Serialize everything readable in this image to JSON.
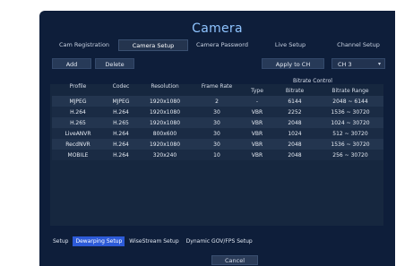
{
  "title": "Camera",
  "tabs": [
    {
      "label": "Cam Registration"
    },
    {
      "label": "Camera Setup"
    },
    {
      "label": "Camera Password"
    },
    {
      "label": "Live Setup"
    },
    {
      "label": "Channel Setup"
    }
  ],
  "active_tab": "Camera Setup",
  "toolbar": {
    "add_label": "Add",
    "delete_label": "Delete",
    "apply_label": "Apply to CH",
    "channel_value": "CH 3"
  },
  "table": {
    "group_header": "Bitrate Control",
    "headers": {
      "profile": "Profile",
      "codec": "Codec",
      "resolution": "Resolution",
      "frame_rate": "Frame Rate",
      "type": "Type",
      "bitrate": "Bitrate",
      "bitrate_range": "Bitrate Range"
    },
    "rows": [
      {
        "profile": "MJPEG",
        "codec": "MJPEG",
        "resolution": "1920x1080",
        "frame_rate": "2",
        "type": "-",
        "bitrate": "6144",
        "range": "2048 ~ 6144"
      },
      {
        "profile": "H.264",
        "codec": "H.264",
        "resolution": "1920x1080",
        "frame_rate": "30",
        "type": "VBR",
        "bitrate": "2252",
        "range": "1536 ~ 30720"
      },
      {
        "profile": "H.265",
        "codec": "H.265",
        "resolution": "1920x1080",
        "frame_rate": "30",
        "type": "VBR",
        "bitrate": "2048",
        "range": "1024 ~ 30720"
      },
      {
        "profile": "LiveANVR",
        "codec": "H.264",
        "resolution": "800x600",
        "frame_rate": "30",
        "type": "VBR",
        "bitrate": "1024",
        "range": "512 ~ 30720"
      },
      {
        "profile": "RecdNVR",
        "codec": "H.264",
        "resolution": "1920x1080",
        "frame_rate": "30",
        "type": "VBR",
        "bitrate": "2048",
        "range": "1536 ~ 30720"
      },
      {
        "profile": "MOBILE",
        "codec": "H.264",
        "resolution": "320x240",
        "frame_rate": "10",
        "type": "VBR",
        "bitrate": "2048",
        "range": "256 ~ 30720"
      }
    ]
  },
  "bottom_tabs": [
    {
      "label": "Setup"
    },
    {
      "label": "Dewarping Setup"
    },
    {
      "label": "WiseStream Setup"
    },
    {
      "label": "Dynamic GOV/FPS Setup"
    }
  ],
  "active_bottom_tab": "Dewarping Setup",
  "footer": {
    "cancel_label": "Cancel"
  },
  "colors": {
    "background": "#0e1e3a",
    "title": "#8fc4ff",
    "active_link": "#2d5bd8"
  }
}
